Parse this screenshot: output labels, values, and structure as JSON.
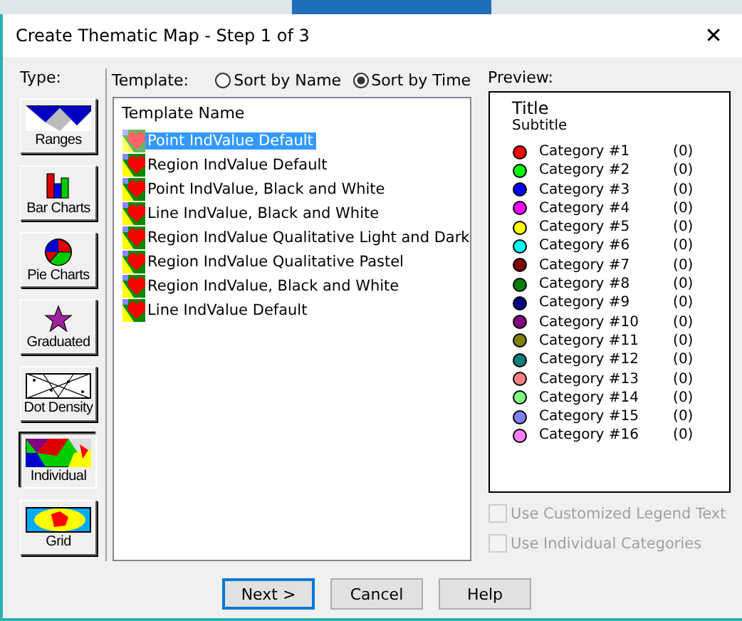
{
  "window": {
    "title": "Create Thematic Map - Step 1 of 3",
    "close": "✕"
  },
  "type_panel": {
    "label": "Type:",
    "types": [
      {
        "kind": "ranges",
        "label": "Ranges",
        "selected": false
      },
      {
        "kind": "bar",
        "label": "Bar Charts",
        "selected": false
      },
      {
        "kind": "pie",
        "label": "Pie Charts",
        "selected": false
      },
      {
        "kind": "graduated",
        "label": "Graduated",
        "selected": false
      },
      {
        "kind": "dot",
        "label": "Dot Density",
        "selected": false
      },
      {
        "kind": "individual",
        "label": "Individual",
        "selected": true
      },
      {
        "kind": "grid",
        "label": "Grid",
        "selected": false
      }
    ]
  },
  "template": {
    "label": "Template:",
    "sort_options": [
      {
        "label": "Sort by Name",
        "selected": false
      },
      {
        "label": "Sort by Time",
        "selected": true
      }
    ],
    "header": "Template Name",
    "items": [
      {
        "label": "Point IndValue Default",
        "selected": true
      },
      {
        "label": "Region IndValue Default",
        "selected": false
      },
      {
        "label": "Point IndValue, Black and White",
        "selected": false
      },
      {
        "label": "Line IndValue, Black and White",
        "selected": false
      },
      {
        "label": "Region IndValue Qualitative Light and Dark",
        "selected": false
      },
      {
        "label": "Region IndValue Qualitative Pastel",
        "selected": false
      },
      {
        "label": "Region IndValue, Black and White",
        "selected": false
      },
      {
        "label": "Line IndValue Default",
        "selected": false
      }
    ]
  },
  "preview": {
    "label": "Preview:",
    "title": "Title",
    "subtitle": "Subtitle",
    "categories": [
      {
        "name": "Category #1",
        "count": "(0)",
        "color": "#ff0000"
      },
      {
        "name": "Category #2",
        "count": "(0)",
        "color": "#00ff00"
      },
      {
        "name": "Category #3",
        "count": "(0)",
        "color": "#0000ff"
      },
      {
        "name": "Category #4",
        "count": "(0)",
        "color": "#ff00ff"
      },
      {
        "name": "Category #5",
        "count": "(0)",
        "color": "#ffff00"
      },
      {
        "name": "Category #6",
        "count": "(0)",
        "color": "#00ffff"
      },
      {
        "name": "Category #7",
        "count": "(0)",
        "color": "#800000"
      },
      {
        "name": "Category #8",
        "count": "(0)",
        "color": "#008000"
      },
      {
        "name": "Category #9",
        "count": "(0)",
        "color": "#000080"
      },
      {
        "name": "Category #10",
        "count": "(0)",
        "color": "#800080"
      },
      {
        "name": "Category #11",
        "count": "(0)",
        "color": "#808000"
      },
      {
        "name": "Category #12",
        "count": "(0)",
        "color": "#008080"
      },
      {
        "name": "Category #13",
        "count": "(0)",
        "color": "#ff8080"
      },
      {
        "name": "Category #14",
        "count": "(0)",
        "color": "#80ff80"
      },
      {
        "name": "Category #15",
        "count": "(0)",
        "color": "#8080ff"
      },
      {
        "name": "Category #16",
        "count": "(0)",
        "color": "#ff80ff"
      }
    ]
  },
  "options": [
    {
      "label": "Use Customized Legend Text",
      "checked": false,
      "disabled": true
    },
    {
      "label": "Use Individual Categories",
      "checked": false,
      "disabled": true
    }
  ],
  "buttons": [
    {
      "label": "Next >",
      "default": true
    },
    {
      "label": "Cancel",
      "default": false
    },
    {
      "label": "Help",
      "default": false
    }
  ]
}
